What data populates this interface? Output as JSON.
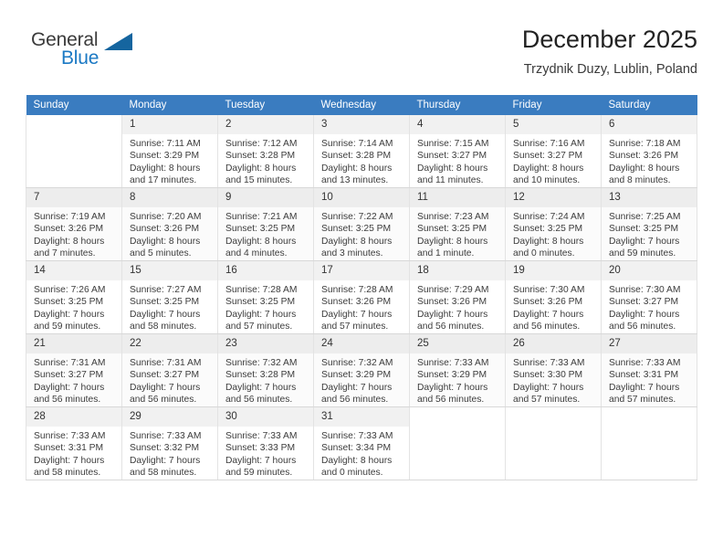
{
  "brand": {
    "name_part1": "General",
    "name_part2": "Blue",
    "triangle_icon": "triangle-logo-icon"
  },
  "header": {
    "title": "December 2025",
    "subtitle": "Trzydnik Duzy, Lublin, Poland"
  },
  "colors": {
    "header_row_bg": "#3a7cc0",
    "brand_blue": "#1b79c4",
    "daynum_bg": "#f1f1f1",
    "alt_row_bg": "#fbfbfb"
  },
  "weekday_headers": [
    "Sunday",
    "Monday",
    "Tuesday",
    "Wednesday",
    "Thursday",
    "Friday",
    "Saturday"
  ],
  "weeks": [
    [
      {
        "day": "",
        "sunrise": "",
        "sunset": "",
        "daylight1": "",
        "daylight2": ""
      },
      {
        "day": "1",
        "sunrise": "Sunrise: 7:11 AM",
        "sunset": "Sunset: 3:29 PM",
        "daylight1": "Daylight: 8 hours",
        "daylight2": "and 17 minutes."
      },
      {
        "day": "2",
        "sunrise": "Sunrise: 7:12 AM",
        "sunset": "Sunset: 3:28 PM",
        "daylight1": "Daylight: 8 hours",
        "daylight2": "and 15 minutes."
      },
      {
        "day": "3",
        "sunrise": "Sunrise: 7:14 AM",
        "sunset": "Sunset: 3:28 PM",
        "daylight1": "Daylight: 8 hours",
        "daylight2": "and 13 minutes."
      },
      {
        "day": "4",
        "sunrise": "Sunrise: 7:15 AM",
        "sunset": "Sunset: 3:27 PM",
        "daylight1": "Daylight: 8 hours",
        "daylight2": "and 11 minutes."
      },
      {
        "day": "5",
        "sunrise": "Sunrise: 7:16 AM",
        "sunset": "Sunset: 3:27 PM",
        "daylight1": "Daylight: 8 hours",
        "daylight2": "and 10 minutes."
      },
      {
        "day": "6",
        "sunrise": "Sunrise: 7:18 AM",
        "sunset": "Sunset: 3:26 PM",
        "daylight1": "Daylight: 8 hours",
        "daylight2": "and 8 minutes."
      }
    ],
    [
      {
        "day": "7",
        "sunrise": "Sunrise: 7:19 AM",
        "sunset": "Sunset: 3:26 PM",
        "daylight1": "Daylight: 8 hours",
        "daylight2": "and 7 minutes."
      },
      {
        "day": "8",
        "sunrise": "Sunrise: 7:20 AM",
        "sunset": "Sunset: 3:26 PM",
        "daylight1": "Daylight: 8 hours",
        "daylight2": "and 5 minutes."
      },
      {
        "day": "9",
        "sunrise": "Sunrise: 7:21 AM",
        "sunset": "Sunset: 3:25 PM",
        "daylight1": "Daylight: 8 hours",
        "daylight2": "and 4 minutes."
      },
      {
        "day": "10",
        "sunrise": "Sunrise: 7:22 AM",
        "sunset": "Sunset: 3:25 PM",
        "daylight1": "Daylight: 8 hours",
        "daylight2": "and 3 minutes."
      },
      {
        "day": "11",
        "sunrise": "Sunrise: 7:23 AM",
        "sunset": "Sunset: 3:25 PM",
        "daylight1": "Daylight: 8 hours",
        "daylight2": "and 1 minute."
      },
      {
        "day": "12",
        "sunrise": "Sunrise: 7:24 AM",
        "sunset": "Sunset: 3:25 PM",
        "daylight1": "Daylight: 8 hours",
        "daylight2": "and 0 minutes."
      },
      {
        "day": "13",
        "sunrise": "Sunrise: 7:25 AM",
        "sunset": "Sunset: 3:25 PM",
        "daylight1": "Daylight: 7 hours",
        "daylight2": "and 59 minutes."
      }
    ],
    [
      {
        "day": "14",
        "sunrise": "Sunrise: 7:26 AM",
        "sunset": "Sunset: 3:25 PM",
        "daylight1": "Daylight: 7 hours",
        "daylight2": "and 59 minutes."
      },
      {
        "day": "15",
        "sunrise": "Sunrise: 7:27 AM",
        "sunset": "Sunset: 3:25 PM",
        "daylight1": "Daylight: 7 hours",
        "daylight2": "and 58 minutes."
      },
      {
        "day": "16",
        "sunrise": "Sunrise: 7:28 AM",
        "sunset": "Sunset: 3:25 PM",
        "daylight1": "Daylight: 7 hours",
        "daylight2": "and 57 minutes."
      },
      {
        "day": "17",
        "sunrise": "Sunrise: 7:28 AM",
        "sunset": "Sunset: 3:26 PM",
        "daylight1": "Daylight: 7 hours",
        "daylight2": "and 57 minutes."
      },
      {
        "day": "18",
        "sunrise": "Sunrise: 7:29 AM",
        "sunset": "Sunset: 3:26 PM",
        "daylight1": "Daylight: 7 hours",
        "daylight2": "and 56 minutes."
      },
      {
        "day": "19",
        "sunrise": "Sunrise: 7:30 AM",
        "sunset": "Sunset: 3:26 PM",
        "daylight1": "Daylight: 7 hours",
        "daylight2": "and 56 minutes."
      },
      {
        "day": "20",
        "sunrise": "Sunrise: 7:30 AM",
        "sunset": "Sunset: 3:27 PM",
        "daylight1": "Daylight: 7 hours",
        "daylight2": "and 56 minutes."
      }
    ],
    [
      {
        "day": "21",
        "sunrise": "Sunrise: 7:31 AM",
        "sunset": "Sunset: 3:27 PM",
        "daylight1": "Daylight: 7 hours",
        "daylight2": "and 56 minutes."
      },
      {
        "day": "22",
        "sunrise": "Sunrise: 7:31 AM",
        "sunset": "Sunset: 3:27 PM",
        "daylight1": "Daylight: 7 hours",
        "daylight2": "and 56 minutes."
      },
      {
        "day": "23",
        "sunrise": "Sunrise: 7:32 AM",
        "sunset": "Sunset: 3:28 PM",
        "daylight1": "Daylight: 7 hours",
        "daylight2": "and 56 minutes."
      },
      {
        "day": "24",
        "sunrise": "Sunrise: 7:32 AM",
        "sunset": "Sunset: 3:29 PM",
        "daylight1": "Daylight: 7 hours",
        "daylight2": "and 56 minutes."
      },
      {
        "day": "25",
        "sunrise": "Sunrise: 7:33 AM",
        "sunset": "Sunset: 3:29 PM",
        "daylight1": "Daylight: 7 hours",
        "daylight2": "and 56 minutes."
      },
      {
        "day": "26",
        "sunrise": "Sunrise: 7:33 AM",
        "sunset": "Sunset: 3:30 PM",
        "daylight1": "Daylight: 7 hours",
        "daylight2": "and 57 minutes."
      },
      {
        "day": "27",
        "sunrise": "Sunrise: 7:33 AM",
        "sunset": "Sunset: 3:31 PM",
        "daylight1": "Daylight: 7 hours",
        "daylight2": "and 57 minutes."
      }
    ],
    [
      {
        "day": "28",
        "sunrise": "Sunrise: 7:33 AM",
        "sunset": "Sunset: 3:31 PM",
        "daylight1": "Daylight: 7 hours",
        "daylight2": "and 58 minutes."
      },
      {
        "day": "29",
        "sunrise": "Sunrise: 7:33 AM",
        "sunset": "Sunset: 3:32 PM",
        "daylight1": "Daylight: 7 hours",
        "daylight2": "and 58 minutes."
      },
      {
        "day": "30",
        "sunrise": "Sunrise: 7:33 AM",
        "sunset": "Sunset: 3:33 PM",
        "daylight1": "Daylight: 7 hours",
        "daylight2": "and 59 minutes."
      },
      {
        "day": "31",
        "sunrise": "Sunrise: 7:33 AM",
        "sunset": "Sunset: 3:34 PM",
        "daylight1": "Daylight: 8 hours",
        "daylight2": "and 0 minutes."
      },
      {
        "day": "",
        "sunrise": "",
        "sunset": "",
        "daylight1": "",
        "daylight2": ""
      },
      {
        "day": "",
        "sunrise": "",
        "sunset": "",
        "daylight1": "",
        "daylight2": ""
      },
      {
        "day": "",
        "sunrise": "",
        "sunset": "",
        "daylight1": "",
        "daylight2": ""
      }
    ]
  ]
}
